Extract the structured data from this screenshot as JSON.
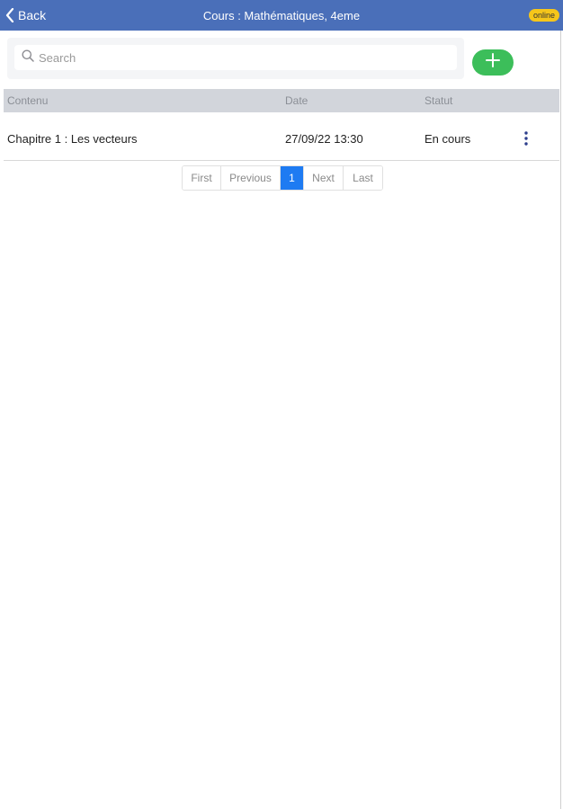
{
  "navbar": {
    "back_label": "Back",
    "title": "Cours : Mathématiques, 4eme",
    "status_badge": "online",
    "background_color": "#4a6fb9",
    "badge_color": "#f6c61a"
  },
  "search": {
    "placeholder": "Search",
    "value": ""
  },
  "add_button": {
    "icon": "plus-icon",
    "color": "#3cbe5a"
  },
  "table": {
    "columns": [
      "Contenu",
      "Date",
      "Statut"
    ],
    "rows": [
      {
        "contenu": "Chapitre 1 : Les vecteurs",
        "date": "27/09/22 13:30",
        "statut": "En cours",
        "menu_icon": "more-vertical-icon"
      }
    ]
  },
  "pagination": {
    "first": "First",
    "previous": "Previous",
    "current": "1",
    "next": "Next",
    "last": "Last",
    "active_color": "#1e7bf2"
  }
}
